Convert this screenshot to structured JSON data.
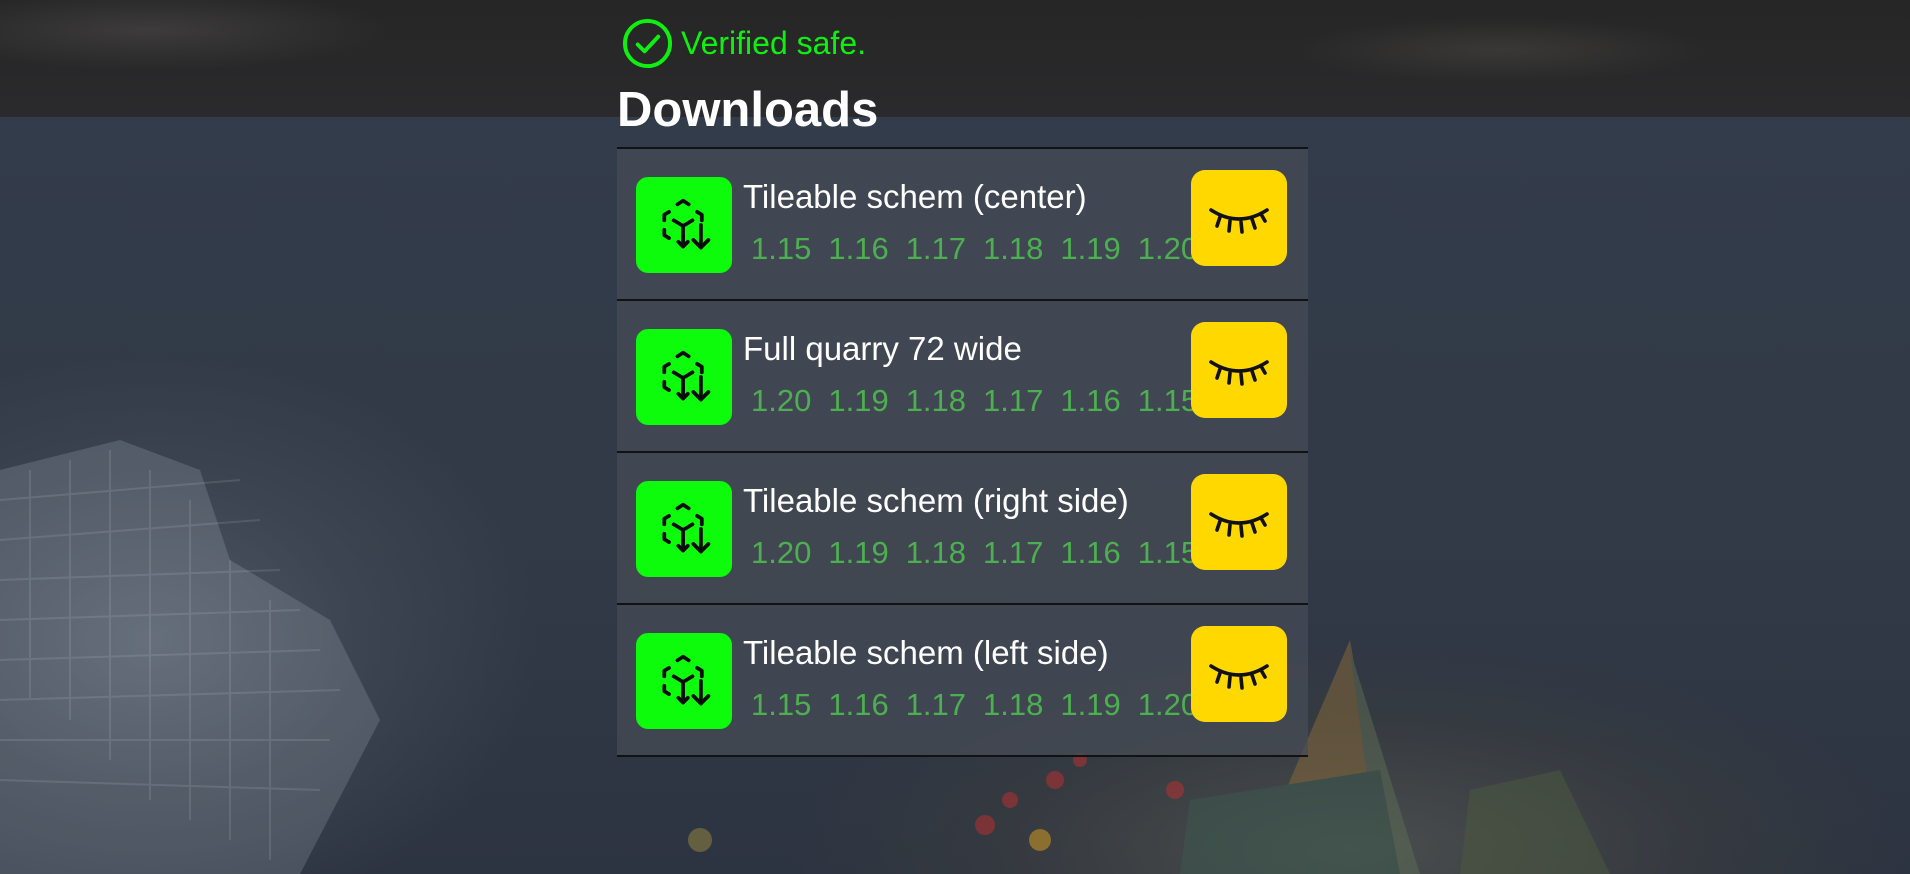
{
  "verified": {
    "text": "Verified safe.",
    "icon": "check-circle-icon",
    "color": "#10f010"
  },
  "page": {
    "heading": "Downloads"
  },
  "colors": {
    "schem_bg": "#0cfc0c",
    "eye_bg": "#ffd800",
    "version_text": "#4caf50"
  },
  "downloads": [
    {
      "name": "Tileable schem (center)",
      "versions": [
        "1.15",
        "1.16",
        "1.17",
        "1.18",
        "1.19",
        "1.20"
      ]
    },
    {
      "name": "Full quarry 72 wide",
      "versions": [
        "1.20",
        "1.19",
        "1.18",
        "1.17",
        "1.16",
        "1.15"
      ]
    },
    {
      "name": "Tileable schem (right side)",
      "versions": [
        "1.20",
        "1.19",
        "1.18",
        "1.17",
        "1.16",
        "1.15"
      ]
    },
    {
      "name": "Tileable schem (left side)",
      "versions": [
        "1.15",
        "1.16",
        "1.17",
        "1.18",
        "1.19",
        "1.20"
      ]
    }
  ]
}
